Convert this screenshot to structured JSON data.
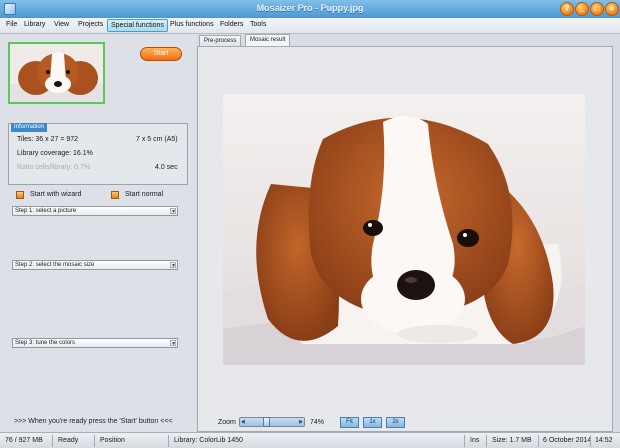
{
  "window": {
    "title": "Mosaizer Pro - Puppy.jpg",
    "buttons": [
      "?",
      "_",
      "□",
      "×"
    ]
  },
  "menu": {
    "items": [
      "File",
      "Library",
      "View",
      "Projects",
      "Special functions",
      "Plus functions",
      "Folders",
      "Tools"
    ],
    "active_index": 4
  },
  "left_panel": {
    "start_label": "Start",
    "info": {
      "heading": "Information",
      "tiles": "Tiles: 36 x 27 = 972",
      "size": "7 x 5 cm  (A5)",
      "coverage": "Library coverage: 16.1%",
      "ratio": "Ratio cells/library: 0.7%",
      "time": "4.0 sec"
    },
    "options": {
      "wizard": "Start with wizard",
      "normal": "Start normal"
    },
    "steps": [
      "Step 1: select a picture",
      "Step 2: select the mosaic size",
      "Step 3: tune the colors"
    ],
    "ready_text": ">>> When you're ready press the 'Start' button <<<"
  },
  "tabs": [
    "Pre-process",
    "Mosaic result"
  ],
  "active_tab_index": 1,
  "zoom": {
    "label": "Zoom",
    "value_text": "74%",
    "value": 0.74,
    "buttons": [
      "Fit",
      "1x",
      "2x"
    ]
  },
  "status": {
    "memory": "76 / 927 MB",
    "state": "Ready",
    "position": "Position",
    "library": "Library: ColorLib 1450",
    "ins": "Ins",
    "size": "Size: 1.7 MB",
    "date": "6 October 2014",
    "time": "14:52"
  },
  "colors": {
    "titlebar": "#4c97d2",
    "accent": "#f26b10",
    "selection": "#5ac85a"
  }
}
